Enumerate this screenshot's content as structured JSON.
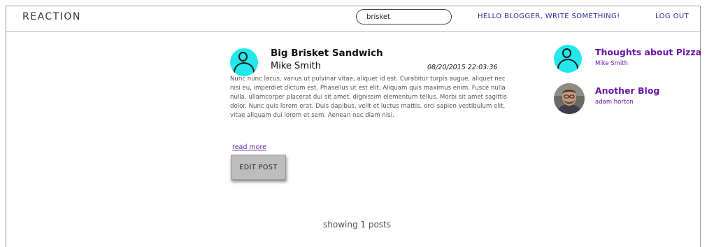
{
  "navbar": {
    "brand": "REACTION",
    "search_value": "brisket",
    "write_link": "HELLO BLOGGER, WRITE SOMETHING!",
    "logout_link": "LOG OUT"
  },
  "post": {
    "title": "Big Brisket Sandwich",
    "author": "Mike Smith",
    "date": "08/20/2015 22:03:36",
    "body": "Nunc nunc lacus, varius ut pulvinar vitae, aliquet id est. Curabitur turpis augue, aliquet nec nisi eu, imperdiet dictum est. Phasellus ut est elit. Aliquam quis maximus enim. Fusce nulla nulla, ullamcorper placerat dui sit amet, dignissim elementum tellus. Morbi sit amet sagittis dolor. Nunc quis lorem erat. Duis dapibus, velit et luctus mattis, orci sapien vestibulum elit, vitae aliquam dui lorem et sem. Aenean nec diam nisi.",
    "read_more": "read more",
    "edit_label": "EDIT POST"
  },
  "sidebar": {
    "items": [
      {
        "title": "Thoughts about Pizza",
        "author": "Mike Smith",
        "avatar": "generic-user-icon"
      },
      {
        "title": "Another Blog",
        "author": "adam horton",
        "avatar": "user-photo"
      }
    ]
  },
  "footer": {
    "count_text": "showing 1 posts"
  },
  "colors": {
    "accent_purple": "#6a16a8",
    "nav_link": "#2b2b9a",
    "avatar_cyan": "#22e8ec",
    "button_gray": "#bdbdbd"
  }
}
